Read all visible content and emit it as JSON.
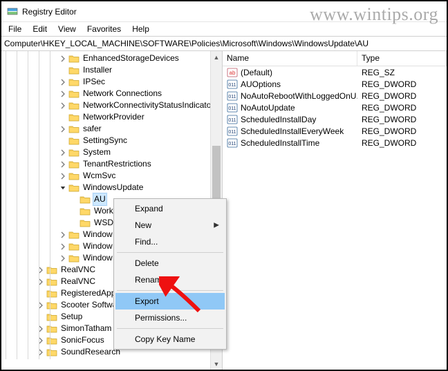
{
  "watermark": "www.wintips.org",
  "window": {
    "title": "Registry Editor"
  },
  "menubar": [
    "File",
    "Edit",
    "View",
    "Favorites",
    "Help"
  ],
  "address": "Computer\\HKEY_LOCAL_MACHINE\\SOFTWARE\\Policies\\Microsoft\\Windows\\WindowsUpdate\\AU",
  "tree": {
    "items": [
      {
        "label": "EnhancedStorageDevices",
        "toggle": ">"
      },
      {
        "label": "Installer",
        "toggle": ""
      },
      {
        "label": "IPSec",
        "toggle": ">"
      },
      {
        "label": "Network Connections",
        "toggle": ">"
      },
      {
        "label": "NetworkConnectivityStatusIndicator",
        "toggle": ">"
      },
      {
        "label": "NetworkProvider",
        "toggle": ""
      },
      {
        "label": "safer",
        "toggle": ">"
      },
      {
        "label": "SettingSync",
        "toggle": ""
      },
      {
        "label": "System",
        "toggle": ">"
      },
      {
        "label": "TenantRestrictions",
        "toggle": ">"
      },
      {
        "label": "WcmSvc",
        "toggle": ">"
      }
    ],
    "wu": {
      "label": "WindowsUpdate",
      "toggle": "v",
      "children": [
        {
          "label": "AU",
          "selected": true
        },
        {
          "label": "Work"
        },
        {
          "label": "WSDA"
        }
      ]
    },
    "after": [
      {
        "label": "Window",
        "toggle": ">"
      },
      {
        "label": "Window",
        "toggle": ">"
      },
      {
        "label": "Window",
        "toggle": ">"
      }
    ],
    "siblings": [
      {
        "label": "RealVNC",
        "toggle": ">"
      },
      {
        "label": "RealVNC",
        "toggle": ">"
      },
      {
        "label": "RegisteredApp",
        "toggle": ""
      },
      {
        "label": "Scooter Softwa",
        "toggle": ">"
      },
      {
        "label": "Setup",
        "toggle": ""
      },
      {
        "label": "SimonTatham",
        "toggle": ">"
      },
      {
        "label": "SonicFocus",
        "toggle": ">"
      },
      {
        "label": "SoundResearch",
        "toggle": ">"
      }
    ]
  },
  "columns": {
    "name": "Name",
    "type": "Type"
  },
  "values": [
    {
      "name": "(Default)",
      "type": "REG_SZ",
      "icon": "string"
    },
    {
      "name": "AUOptions",
      "type": "REG_DWORD",
      "icon": "dword"
    },
    {
      "name": "NoAutoRebootWithLoggedOnU...",
      "type": "REG_DWORD",
      "icon": "dword"
    },
    {
      "name": "NoAutoUpdate",
      "type": "REG_DWORD",
      "icon": "dword"
    },
    {
      "name": "ScheduledInstallDay",
      "type": "REG_DWORD",
      "icon": "dword"
    },
    {
      "name": "ScheduledInstallEveryWeek",
      "type": "REG_DWORD",
      "icon": "dword"
    },
    {
      "name": "ScheduledInstallTime",
      "type": "REG_DWORD",
      "icon": "dword"
    }
  ],
  "context_menu": {
    "items": [
      {
        "label": "Expand"
      },
      {
        "label": "New",
        "submenu": true
      },
      {
        "label": "Find..."
      },
      {
        "sep": true
      },
      {
        "label": "Delete"
      },
      {
        "label": "Rename"
      },
      {
        "sep": true
      },
      {
        "label": "Export",
        "hover": true
      },
      {
        "label": "Permissions..."
      },
      {
        "sep": true
      },
      {
        "label": "Copy Key Name"
      }
    ]
  }
}
